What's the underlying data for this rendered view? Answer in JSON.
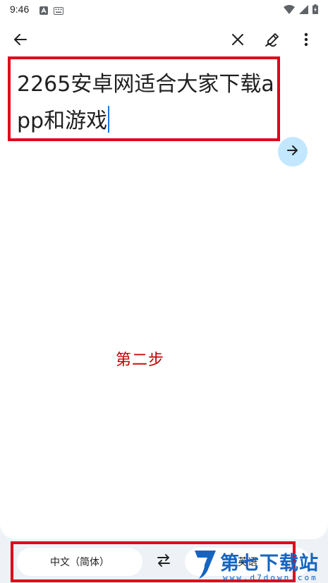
{
  "status_bar": {
    "time": "9:46",
    "icons": [
      "android-notification-icon",
      "keyboard-icon",
      "wifi-icon",
      "signal-icon",
      "battery-charging-icon"
    ]
  },
  "toolbar": {
    "back_icon": "arrow-back-icon",
    "clear_icon": "close-icon",
    "handwriting_icon": "pen-edit-icon",
    "more_icon": "more-vert-icon"
  },
  "input": {
    "text": "2265安卓网适合大家下载app和游戏"
  },
  "go_button": {
    "icon": "arrow-forward-icon"
  },
  "annotation": {
    "step": "第二步"
  },
  "languages": {
    "source": "中文（简体）",
    "target": "英语",
    "swap_icon": "swap-arrows-icon"
  },
  "watermark": {
    "brand": "第七下载站",
    "url": "www.d7down.com"
  },
  "colors": {
    "accent_red": "#e0001b",
    "go_button_bg": "#c2e7ff",
    "caret": "#1a73e8",
    "watermark_blue": "#1565c0",
    "step_text": "#c00000"
  }
}
